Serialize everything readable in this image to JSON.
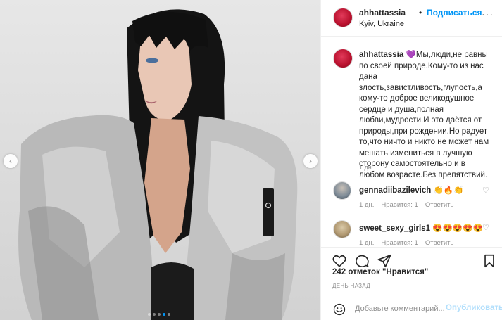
{
  "post": {
    "username": "ahhattassia",
    "follow_label": "Подписаться",
    "separator": "•",
    "location": "Kyiv, Ukraine",
    "more_label": "···"
  },
  "caption": {
    "username": "ahhattassia",
    "heart": "💜",
    "text": "Мы,люди,не равны по своей природе.Кому-то из нас дана злость,завистливость,глупость,а кому-то доброе великодушное сердце и душа,полная любви,мудрости.И это даётся от природы,при рождении.Но радует то,что ничто и никто не может нам мешать измениться в лучшую сторону самостоятельно и в любом возрасте.Без препятствий.",
    "time": "1 дн."
  },
  "comments": [
    {
      "username": "gennadiibazilevich",
      "text": "👏🔥👏",
      "time": "1 дн.",
      "like_label": "Нравится: 1",
      "reply_label": "Ответить"
    },
    {
      "username": "sweet_sexy_girls1",
      "text": "😍😍😍😍😍",
      "time": "1 дн.",
      "like_label": "Нравится: 1",
      "reply_label": "Ответить"
    }
  ],
  "actions": {
    "likes_text": "242 отметок \"Нравится\"",
    "post_time": "ДЕНЬ НАЗАД"
  },
  "add_comment": {
    "placeholder": "Добавьте комментарий...",
    "publish_label": "Опубликовать"
  },
  "carousel": {
    "prev_label": "‹",
    "next_label": "›",
    "slide_count": 5,
    "active_slide": 4
  },
  "colors": {
    "accent": "#0095f6",
    "publish_disabled": "#b2dffc",
    "muted": "#8e8e8e",
    "text": "#262626",
    "border": "#efefef"
  },
  "icons": {
    "like": "heart-outline-icon",
    "comment": "comment-bubble-icon",
    "share": "paper-plane-icon",
    "save": "bookmark-icon",
    "emoji": "smiley-icon"
  }
}
